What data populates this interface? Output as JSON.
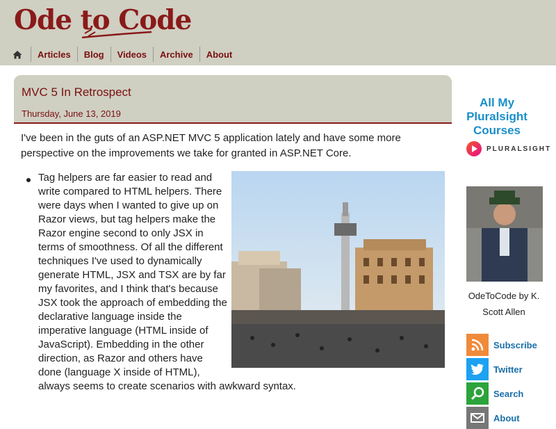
{
  "site": {
    "logo": "Ode to Code"
  },
  "nav": {
    "home_icon": "home-icon",
    "items": [
      "Articles",
      "Blog",
      "Videos",
      "Archive",
      "About"
    ]
  },
  "post": {
    "title": "MVC 5 In Retrospect",
    "date": "Thursday, June 13, 2019",
    "intro": "I've been in the guts of an ASP.NET MVC 5 application lately and have some more perspective on the improvements we take for granted in ASP.NET Core.",
    "bullet": "Tag helpers are far easier to read and write compared to HTML helpers. There were days when I wanted to give up on Razor views, but tag helpers make the Razor engine second to only JSX in terms of smoothness. Of all the different techniques I've used to dynamically generate HTML, JSX and TSX are by far my favorites, and I think that's because JSX took the approach of embedding the declarative language inside the imperative language (HTML inside of JavaScript). Embedding in the other direction, as Razor and others have done (language X inside of HTML), always seems to create scenarios with awkward syntax."
  },
  "sidebar": {
    "courses_link": "All My Pluralsight Courses",
    "pluralsight_logo": "PLURALSIGHT",
    "caption": "OdeToCode by K. Scott Allen",
    "social": [
      {
        "label": "Subscribe",
        "icon": "rss-icon",
        "color": "#f08a3b"
      },
      {
        "label": "Twitter",
        "icon": "twitter-icon",
        "color": "#1da1f2"
      },
      {
        "label": "Search",
        "icon": "search-icon",
        "color": "#2da33b"
      },
      {
        "label": "About",
        "icon": "envelope-icon",
        "color": "#777777"
      }
    ]
  },
  "colors": {
    "accent": "#8a1a1a",
    "header_bg": "#cfcfc2",
    "link_blue": "#1a8fc9"
  }
}
